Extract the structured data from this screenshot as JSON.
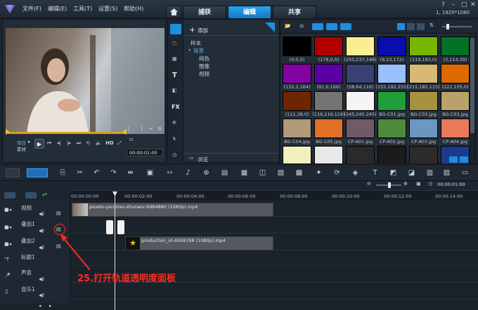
{
  "menu": [
    "文件(F)",
    "编辑(E)",
    "工具(T)",
    "设置(S)",
    "帮助(H)"
  ],
  "tabs": [
    "捕获",
    "编辑",
    "共享"
  ],
  "resolution": "1, 1920*1080",
  "preview": {
    "mode_project": "项目",
    "mode_clip": "素材",
    "hd": "HD",
    "timecode": "00:00:01:00"
  },
  "library": {
    "add": "添加",
    "root": "样本",
    "selected": "背景",
    "children": [
      "纯色",
      "图像",
      "视频"
    ],
    "browse": "浏览",
    "fx": "FX"
  },
  "thumbs": [
    {
      "label": "(0,0,0)",
      "color": "#000000"
    },
    {
      "label": "(178,0,0)",
      "color": "#b20000"
    },
    {
      "label": "(250,237,146)",
      "color": "#faed92"
    },
    {
      "label": "(9,13,172)",
      "color": "#090dac"
    },
    {
      "label": "(119,183,0)",
      "color": "#77b700"
    },
    {
      "label": "(3,114,39)",
      "color": "#037227"
    },
    {
      "label": "(132,2,164)",
      "color": "#8402a4"
    },
    {
      "label": "(91,0,166)",
      "color": "#5b00a6"
    },
    {
      "label": "(58,64,116)",
      "color": "#3a4074"
    },
    {
      "label": "(155,192,255)",
      "color": "#9bc0ff"
    },
    {
      "label": "(215,185,115)",
      "color": "#d7b973"
    },
    {
      "label": "(221,105,0)",
      "color": "#dd6900"
    },
    {
      "label": "(111,38,0)",
      "color": "#6f2600"
    },
    {
      "label": "(116,116,116)",
      "color": "#747474"
    },
    {
      "label": "(245,245,245)",
      "color": "#f5f5f5"
    },
    {
      "label": "BG-C01.jpg",
      "color": "#1f9e3a"
    },
    {
      "label": "BG-C02.jpg",
      "color": "#a8913f"
    },
    {
      "label": "BG-C03.jpg",
      "color": "#b8a26a"
    },
    {
      "label": "BG-C04.jpg",
      "color": "#b09a7a"
    },
    {
      "label": "BG-C05.jpg",
      "color": "#e0702a"
    },
    {
      "label": "CP-A01.jpg",
      "color": "#6f5a66"
    },
    {
      "label": "CP-A02.jpg",
      "color": "#4e8a3a"
    },
    {
      "label": "CP-A03.jpg",
      "color": "#6a98c0"
    },
    {
      "label": "CP-A04.jpg",
      "color": "#e87a5a"
    }
  ],
  "timeline": {
    "ticks": [
      "00:00:00:00",
      "00:00:02:00",
      "00:00:04:00",
      "00:00:06:00",
      "00:00:08:00",
      "00:00:10:00",
      "00:00:12:00",
      "00:00:14:00"
    ],
    "zoom_time": "00:00:01:00",
    "tracks": [
      "视频",
      "叠加1",
      "叠加2",
      "标题1",
      "声音",
      "音乐1"
    ],
    "clip1": "pexels-yaroslav-shuraev-6984880 (1080p).mp4",
    "clip2": "production_id-4958798 (1080p).mp4"
  },
  "annotation": "25.打开轨道透明度面板",
  "colors": {
    "accent": "#1d8ee0",
    "annotation": "#ff2a1f"
  }
}
